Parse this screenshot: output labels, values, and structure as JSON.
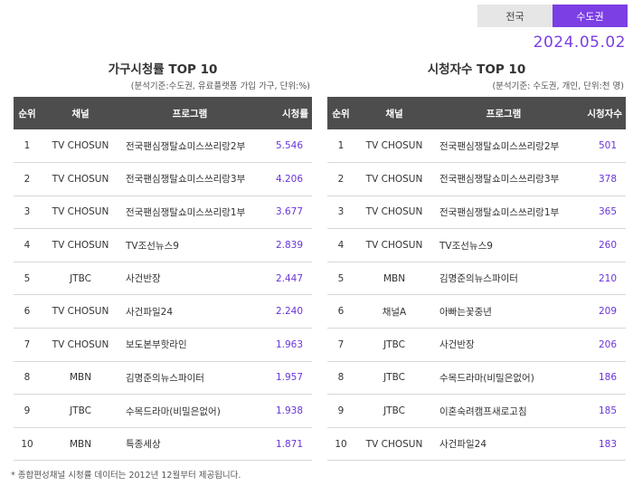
{
  "region_tabs": [
    {
      "label": "전국",
      "active": false
    },
    {
      "label": "수도권",
      "active": true
    }
  ],
  "date": "2024.05.02",
  "left_panel": {
    "title": "가구시청률 TOP 10",
    "note": "(분석기준:수도권, 유료플랫폼 가입 가구, 단위:%)",
    "headers": [
      "순위",
      "채널",
      "프로그램",
      "시청률"
    ],
    "rows": [
      {
        "rank": "1",
        "channel": "TV CHOSUN",
        "program": "전국팬심쟁탈쇼미스쓰리랑2부",
        "value": "5.546"
      },
      {
        "rank": "2",
        "channel": "TV CHOSUN",
        "program": "전국팬심쟁탈쇼미스쓰리랑3부",
        "value": "4.206"
      },
      {
        "rank": "3",
        "channel": "TV CHOSUN",
        "program": "전국팬심쟁탈쇼미스쓰리랑1부",
        "value": "3.677"
      },
      {
        "rank": "4",
        "channel": "TV CHOSUN",
        "program": "TV조선뉴스9",
        "value": "2.839"
      },
      {
        "rank": "5",
        "channel": "JTBC",
        "program": "사건반장",
        "value": "2.447"
      },
      {
        "rank": "6",
        "channel": "TV CHOSUN",
        "program": "사건파일24",
        "value": "2.240"
      },
      {
        "rank": "7",
        "channel": "TV CHOSUN",
        "program": "보도본부핫라인",
        "value": "1.963"
      },
      {
        "rank": "8",
        "channel": "MBN",
        "program": "김명준의뉴스파이터",
        "value": "1.957"
      },
      {
        "rank": "9",
        "channel": "JTBC",
        "program": "수목드라마(비밀은없어)",
        "value": "1.938"
      },
      {
        "rank": "10",
        "channel": "MBN",
        "program": "특종세상",
        "value": "1.871"
      }
    ]
  },
  "right_panel": {
    "title": "시청자수 TOP 10",
    "note": "(분석기준: 수도권, 개인, 단위:천 명)",
    "headers": [
      "순위",
      "채널",
      "프로그램",
      "시청자수"
    ],
    "rows": [
      {
        "rank": "1",
        "channel": "TV CHOSUN",
        "program": "전국팬심쟁탈쇼미스쓰리랑2부",
        "value": "501"
      },
      {
        "rank": "2",
        "channel": "TV CHOSUN",
        "program": "전국팬심쟁탈쇼미스쓰리랑3부",
        "value": "378"
      },
      {
        "rank": "3",
        "channel": "TV CHOSUN",
        "program": "전국팬심쟁탈쇼미스쓰리랑1부",
        "value": "365"
      },
      {
        "rank": "4",
        "channel": "TV CHOSUN",
        "program": "TV조선뉴스9",
        "value": "260"
      },
      {
        "rank": "5",
        "channel": "MBN",
        "program": "김명준의뉴스파이터",
        "value": "210"
      },
      {
        "rank": "6",
        "channel": "채널A",
        "program": "아빠는꽃중년",
        "value": "209"
      },
      {
        "rank": "7",
        "channel": "JTBC",
        "program": "사건반장",
        "value": "206"
      },
      {
        "rank": "8",
        "channel": "JTBC",
        "program": "수목드라마(비밀은없어)",
        "value": "186"
      },
      {
        "rank": "9",
        "channel": "JTBC",
        "program": "이혼숙려캠프새로고침",
        "value": "185"
      },
      {
        "rank": "10",
        "channel": "TV CHOSUN",
        "program": "사건파일24",
        "value": "183"
      }
    ]
  },
  "footnote": "* 종합편성채널 시청률 데이터는 2012년 12월부터 제공됩니다.",
  "colors": {
    "accent": "#7b3fe4",
    "header_bg": "#4d4d4d",
    "value_text": "#6a35d9"
  }
}
